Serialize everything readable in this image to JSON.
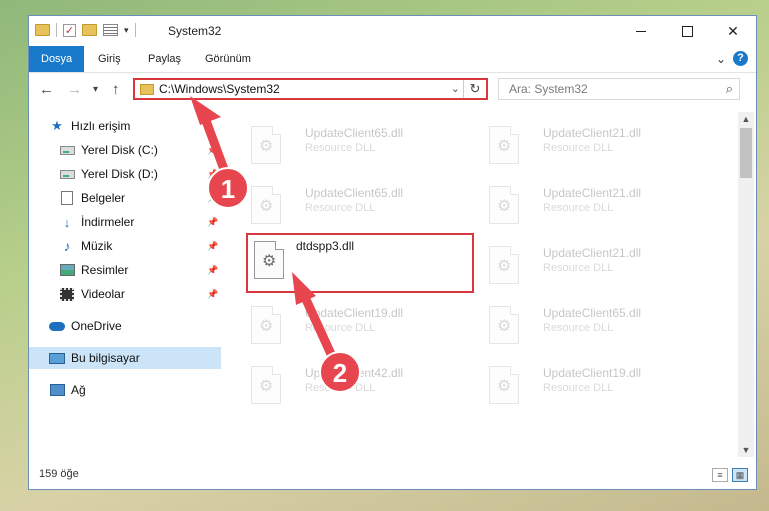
{
  "window": {
    "title": "System32",
    "controls": {
      "minimize": "",
      "maximize": "",
      "close": "✕"
    }
  },
  "ribbon": {
    "tabs": [
      {
        "label": "Dosya",
        "active": true
      },
      {
        "label": "Giriş"
      },
      {
        "label": "Paylaş"
      },
      {
        "label": "Görünüm"
      }
    ],
    "help": "?"
  },
  "nav": {
    "address_path": "C:\\Windows\\System32",
    "search_placeholder": "Ara: System32"
  },
  "sidebar": {
    "items": [
      {
        "label": "Hızlı erişim",
        "icon": "star-icon"
      },
      {
        "label": "Yerel Disk (C:)",
        "icon": "drive-icon"
      },
      {
        "label": "Yerel Disk (D:)",
        "icon": "drive-icon"
      },
      {
        "label": "Belgeler",
        "icon": "document-icon"
      },
      {
        "label": "İndirmeler",
        "icon": "download-icon"
      },
      {
        "label": "Müzik",
        "icon": "music-icon"
      },
      {
        "label": "Resimler",
        "icon": "pictures-icon"
      },
      {
        "label": "Videolar",
        "icon": "video-icon"
      },
      {
        "label": "OneDrive",
        "icon": "cloud-icon"
      },
      {
        "label": "Bu bilgisayar",
        "icon": "computer-icon",
        "selected": true
      },
      {
        "label": "Ağ",
        "icon": "network-icon"
      }
    ]
  },
  "files": [
    {
      "name": "UpdateClient65.dll",
      "desc": "Resource DLL"
    },
    {
      "name": "UpdateClient21.dll",
      "desc": "Resource DLL"
    },
    {
      "name": "UpdateClient65.dll",
      "desc": "Resource DLL"
    },
    {
      "name": "UpdateClient21.dll",
      "desc": "Resource DLL"
    },
    {
      "name": "dtdspp3.dll",
      "desc": ""
    },
    {
      "name": "UpdateClient21.dll",
      "desc": "Resource DLL"
    },
    {
      "name": "UpdateClient19.dll",
      "desc": "Resource DLL"
    },
    {
      "name": "UpdateClient65.dll",
      "desc": "Resource DLL"
    },
    {
      "name": "UpdateClient42.dll",
      "desc": "Resource DLL"
    },
    {
      "name": "UpdateClient19.dll",
      "desc": "Resource DLL"
    }
  ],
  "status": {
    "item_count": "159 öğe"
  },
  "annotations": {
    "step1": "1",
    "step2": "2",
    "color": "#e8464e"
  }
}
